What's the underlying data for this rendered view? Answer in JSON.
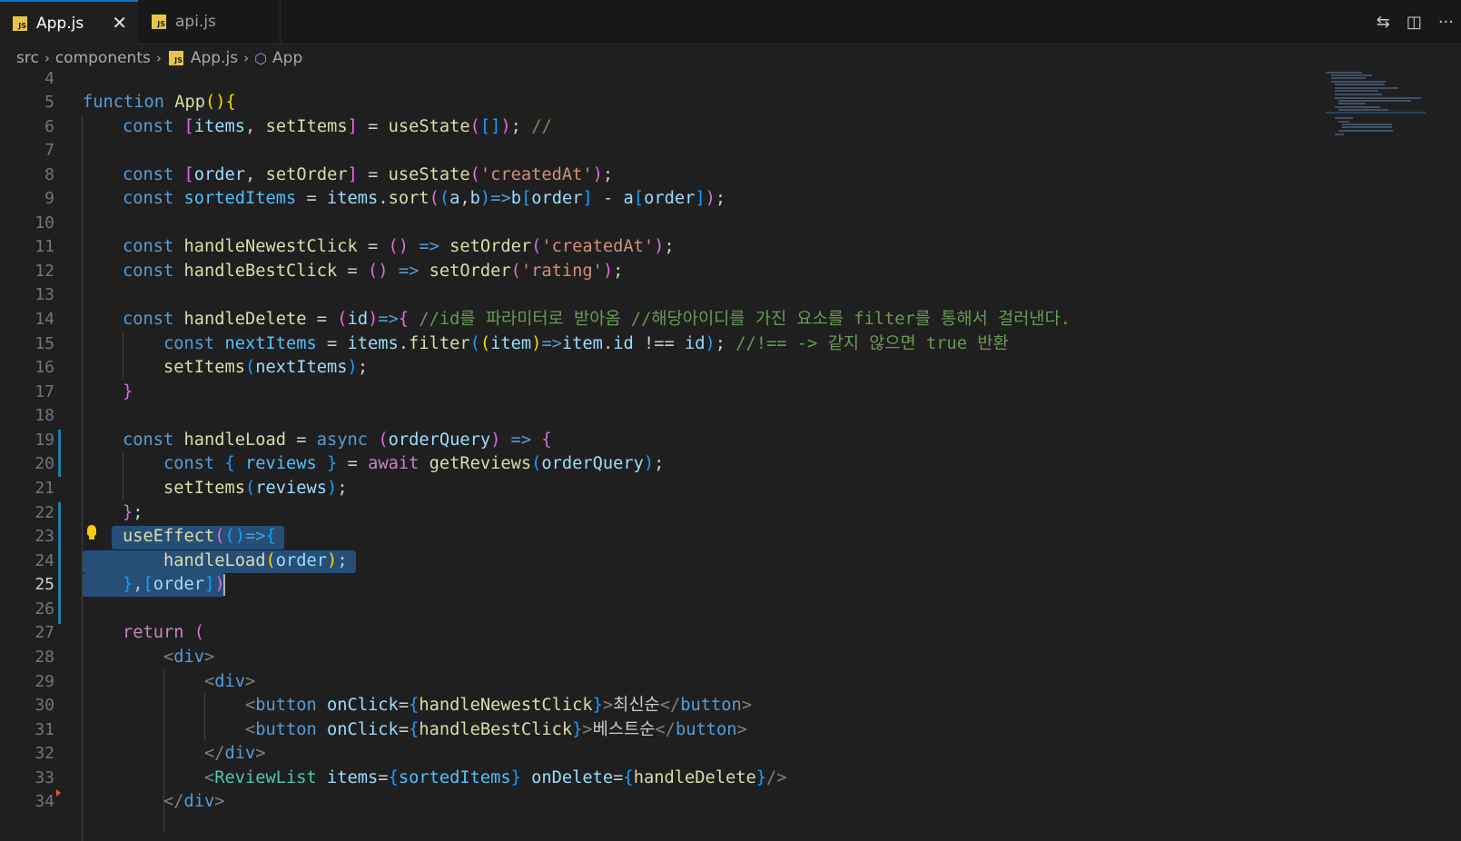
{
  "tabs": [
    {
      "label": "App.js",
      "icon": "js-file-icon",
      "active": true,
      "close_glyph": "✕"
    },
    {
      "label": "api.js",
      "icon": "js-file-icon",
      "active": false
    }
  ],
  "tab_actions": {
    "compare_icon": "⇆",
    "split_icon": "◫",
    "more_icon": "···"
  },
  "breadcrumb": {
    "items": [
      "src",
      "components",
      "App.js",
      "App"
    ],
    "separator": "›",
    "js_badge": "JS",
    "symbol_icon": "⬡"
  },
  "editor": {
    "line_numbers": [
      "4",
      "5",
      "6",
      "7",
      "8",
      "9",
      "10",
      "11",
      "12",
      "13",
      "14",
      "15",
      "16",
      "17",
      "18",
      "19",
      "20",
      "21",
      "22",
      "23",
      "24",
      "25",
      "26",
      "27",
      "28",
      "29",
      "30",
      "31",
      "32",
      "33",
      "34"
    ],
    "current_line": "25",
    "lines": {
      "l5": [
        "function ",
        "App",
        "()",
        "{"
      ],
      "l6": [
        "const ",
        "[",
        "items",
        ", ",
        "setItems",
        "]",
        " = ",
        "useState",
        "(",
        "[]",
        ")",
        "; ",
        "//"
      ],
      "l8": [
        "const ",
        "[",
        "order",
        ", ",
        "setOrder",
        "]",
        " = ",
        "useState",
        "(",
        "'createdAt'",
        ")",
        ";"
      ],
      "l9": [
        "const ",
        "sortedItems",
        " = ",
        "items",
        ".",
        "sort",
        "(",
        "(",
        "a",
        ",",
        "b",
        ")",
        "=>",
        "b",
        "[",
        "order",
        "]",
        " - ",
        "a",
        "[",
        "order",
        "]",
        ")",
        ";"
      ],
      "l11": [
        "const ",
        "handleNewestClick",
        " = ",
        "()",
        " => ",
        "setOrder",
        "(",
        "'createdAt'",
        ")",
        ";"
      ],
      "l12": [
        "const ",
        "handleBestClick",
        " = ",
        "()",
        " => ",
        "setOrder",
        "(",
        "'rating'",
        ")",
        ";"
      ],
      "l14": [
        "const ",
        "handleDelete",
        " = ",
        "(",
        "id",
        ")",
        "=>",
        "{",
        " //id를 파라미터로 받아옴 //해당아이디를 가진 요소를 filter를 통해서 걸러낸다."
      ],
      "l15": [
        "const ",
        "nextItems",
        " = ",
        "items",
        ".",
        "filter",
        "(",
        "(",
        "item",
        ")",
        "=>",
        "item",
        ".",
        "id",
        " !== ",
        "id",
        ")",
        "; ",
        "//!== -> 같지 않으면 true 반환"
      ],
      "l16": [
        "setItems",
        "(",
        "nextItems",
        ")",
        ";"
      ],
      "l17": [
        "}"
      ],
      "l19": [
        "const ",
        "handleLoad",
        " = ",
        "async ",
        "(",
        "orderQuery",
        ")",
        " => ",
        "{"
      ],
      "l20": [
        "const ",
        "{ ",
        "reviews",
        " }",
        " = ",
        "await ",
        "getReviews",
        "(",
        "orderQuery",
        ")",
        ";"
      ],
      "l21": [
        "setItems",
        "(",
        "reviews",
        ")",
        ";"
      ],
      "l22": [
        "}",
        ";"
      ],
      "l23": [
        "useEffect",
        "(",
        "()",
        "=>",
        "{"
      ],
      "l24": [
        "handleLoad",
        "(",
        "order",
        ")",
        ";"
      ],
      "l25": [
        "}",
        ",",
        "[",
        "order",
        "]",
        ")"
      ],
      "l27": [
        "return ",
        "("
      ],
      "l28": [
        "<",
        "div",
        ">"
      ],
      "l29": [
        "<",
        "div",
        ">"
      ],
      "l30": [
        "<",
        "button",
        " ",
        "onClick",
        "=",
        "{",
        "handleNewestClick",
        "}",
        ">",
        "최신순",
        "</",
        "button",
        ">"
      ],
      "l31": [
        "<",
        "button",
        " ",
        "onClick",
        "=",
        "{",
        "handleBestClick",
        "}",
        ">",
        "베스트순",
        "</",
        "button",
        ">"
      ],
      "l32": [
        "</",
        "div",
        ">"
      ],
      "l33": [
        "<",
        "ReviewList",
        " ",
        "items",
        "=",
        "{",
        "sortedItems",
        "}",
        " ",
        "onDelete",
        "=",
        "{",
        "handleDelete",
        "}",
        "/>"
      ],
      "l34": [
        "</",
        "div",
        ">"
      ]
    }
  },
  "colors": {
    "editor_bg": "#1f1f1f",
    "keyword": "#569cd6",
    "control": "#c586c0",
    "function": "#dcdcaa",
    "variable": "#9cdcfe",
    "string": "#ce9178",
    "comment": "#6a9955",
    "selection": "#264f78",
    "accent": "#0078d4"
  }
}
